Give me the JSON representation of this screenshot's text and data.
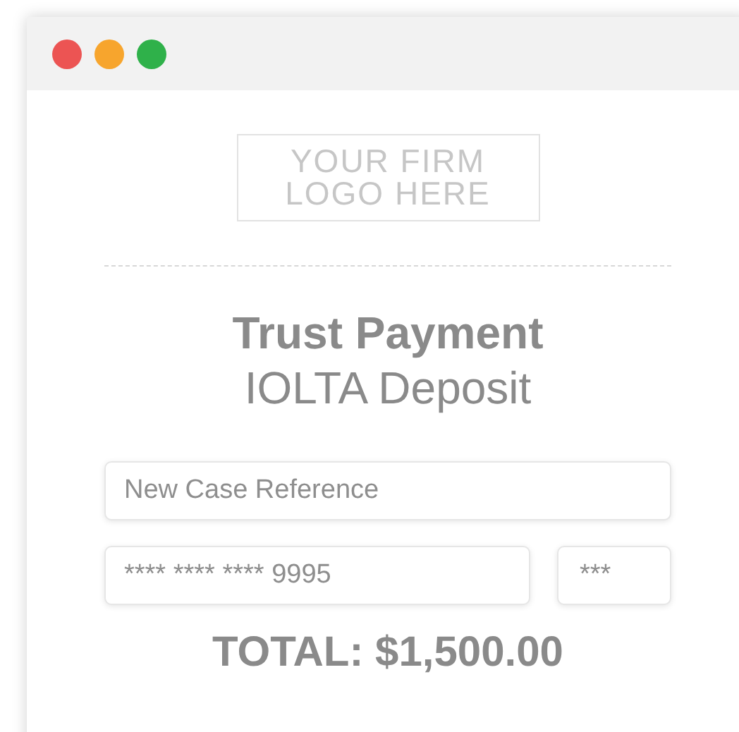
{
  "window": {
    "controls": [
      {
        "color": "#ec5453"
      },
      {
        "color": "#f7a52d"
      },
      {
        "color": "#2fb14a"
      }
    ]
  },
  "logo": {
    "lines": [
      "YOUR FIRM",
      "LOGO HERE"
    ]
  },
  "heading": {
    "title": "Trust Payment",
    "subtitle": "IOLTA Deposit"
  },
  "fields": [
    {
      "kind": "reference",
      "value": "New Case Reference"
    },
    {
      "kind": "card",
      "value": "**** **** **** 9995"
    },
    {
      "kind": "cvv",
      "value": "***"
    }
  ],
  "total": "TOTAL: $1,500.00"
}
